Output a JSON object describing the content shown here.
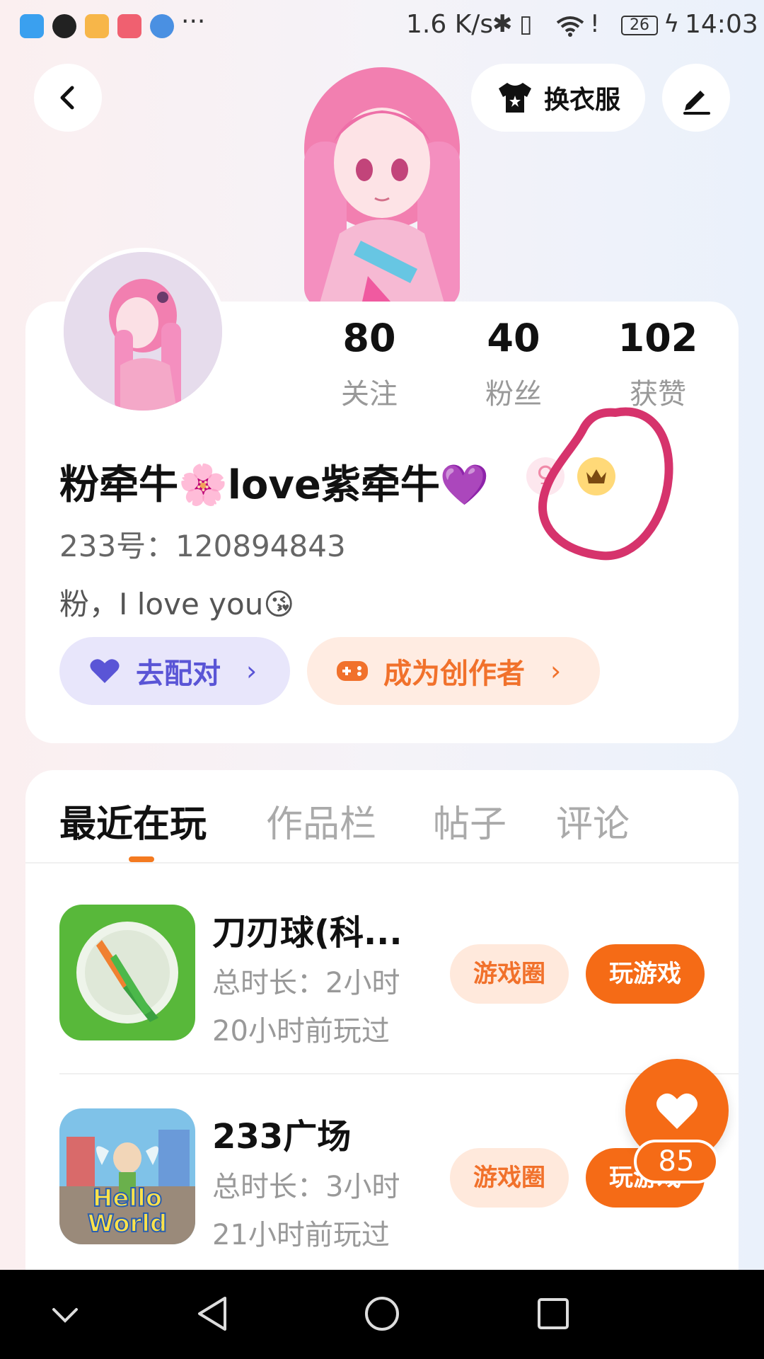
{
  "status_bar": {
    "network_speed": "1.6 K/s",
    "battery": "26",
    "time": "14:03",
    "overflow": "···"
  },
  "header": {
    "outfit_label": "换衣服"
  },
  "stats": [
    {
      "value": "80",
      "label": "关注"
    },
    {
      "value": "40",
      "label": "粉丝"
    },
    {
      "value": "102",
      "label": "获赞"
    }
  ],
  "profile": {
    "name": "粉牵牛🌸love紫牵牛💜",
    "gender_symbol": "♀",
    "uid": "233号：120894843",
    "bio": "粉，I love you😘"
  },
  "actions": {
    "match_label": "去配对",
    "creator_label": "成为创作者",
    "chevron": "›"
  },
  "tabs": [
    "最近在玩",
    "作品栏",
    "帖子",
    "评论"
  ],
  "games": [
    {
      "title": "刀刃球(科...",
      "duration": "总时长：2小时",
      "last_played": "20小时前玩过",
      "circle_label": "游戏圈",
      "play_label": "玩游戏"
    },
    {
      "title": "233广场",
      "duration": "总时长：3小时",
      "last_played": "21小时前玩过",
      "circle_label": "游戏圈",
      "play_label": "玩游戏",
      "icon_text_1": "Hello",
      "icon_text_2": "World"
    }
  ],
  "like_count": "85",
  "colors": {
    "accent_orange": "#f56b16",
    "match_purple": "#5a55d6",
    "annotation_pink": "#d6336c"
  }
}
